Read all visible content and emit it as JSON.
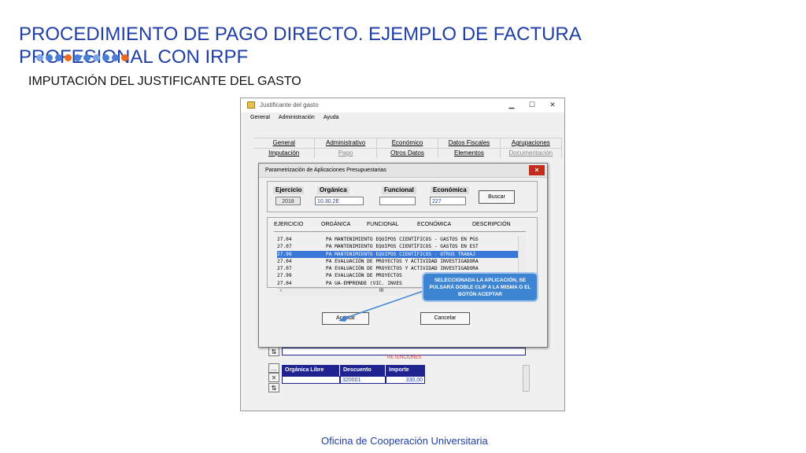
{
  "slide": {
    "title": "PROCEDIMIENTO DE PAGO DIRECTO. EJEMPLO DE FACTURA PROFESIONAL CON IRPF",
    "subtitle": "IMPUTACIÓN DEL JUSTIFICANTE DEL GASTO",
    "footer": "Oficina de Cooperación Universitaria"
  },
  "window": {
    "title": "Justificante del gasto",
    "menu": [
      "General",
      "Administración",
      "Ayuda"
    ],
    "tabs_row1": [
      "General",
      "Administrativo",
      "Económico",
      "Datos Fiscales",
      "Agrupaciones"
    ],
    "tabs_row2": [
      "Imputación",
      "Pago",
      "Otros Datos",
      "Elementos",
      "Documentación"
    ]
  },
  "dialog": {
    "title": "Parametrización de Aplicaciones Presupuestarias",
    "close": "×",
    "filters": {
      "ejercicio_label": "Ejercicio",
      "ejercicio_value": "2018",
      "organica_label": "Orgánica",
      "organica_value": "10.30.2E",
      "funcional_label": "Funcional",
      "funcional_value": "",
      "economica_label": "Económica",
      "economica_value": "227"
    },
    "buscar": "Buscar",
    "columns": [
      "EJERCICIO",
      "ORGÁNICA",
      "FUNCIONAL",
      "ECONÓMICA",
      "DESCRIPCIÓN"
    ],
    "rows": [
      {
        "code": "27.04",
        "text": "PA MANTENIMIENTO EQUIPOS CIENTÍFICOS - GASTOS EN PGS"
      },
      {
        "code": "27.07",
        "text": "PA MANTENIMIENTO EQUIPOS CIENTÍFICOS - GASTOS EN EST"
      },
      {
        "code": "27.99",
        "text": "PA MANTENIMIENTO EQUIPOS CIENTÍFICOS - OTROS TRABAJ"
      },
      {
        "code": "27.04",
        "text": "PA EVALUACIÓN DE PROYECTOS Y ACTIVIDAD INVESTIGADORA"
      },
      {
        "code": "27.07",
        "text": "PA EVALUACIÓN DE PROYECTOS Y ACTIVIDAD INVESTIGADORA"
      },
      {
        "code": "27.99",
        "text": "PA EVALUACIÓN DE PROYECTOS"
      },
      {
        "code": "27.04",
        "text": "PA UA-EMPRENDE (VIC. INVES"
      }
    ],
    "selected_row": 2,
    "hscroll_mark": "III",
    "aceptar": "Aceptar",
    "cancelar": "Cancelar",
    "callout": "SELECCIONADA LA APLICACIÓN, SE PULSARÁ DOBLE CLIP A LA MISMA O EL BOTÓN ACEPTAR"
  },
  "retenciones": {
    "title": "RETENCIONES",
    "columns": [
      "Orgánica Libre",
      "Descuento",
      "Importe"
    ],
    "row": {
      "organica": "",
      "descuento": "320001",
      "importe": "330,00"
    }
  },
  "icons": {
    "sort": "sort-icon",
    "delete": "delete-icon",
    "app": "app-icon"
  },
  "colors": {
    "title": "#1f3ea6",
    "selection": "#3a78d8",
    "table_header": "#1e238f",
    "callout": "#3d85d3",
    "close": "#c42b1c"
  }
}
